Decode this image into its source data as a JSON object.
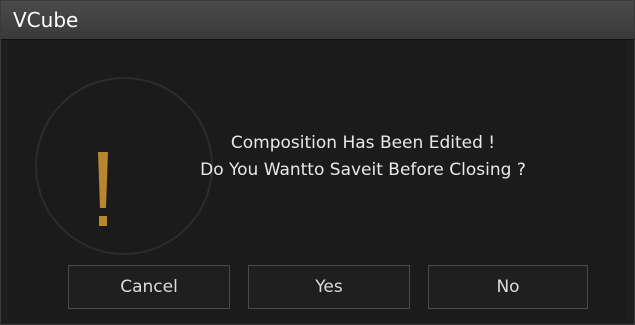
{
  "window": {
    "title": "VCube"
  },
  "dialog": {
    "icon": "warning-exclamation-icon",
    "message_line1": "Composition Has Been Edited !",
    "message_line2": "Do You Wantto Saveit Before Closing ?",
    "accent_color": "#b8862e"
  },
  "buttons": {
    "cancel": "Cancel",
    "yes": "Yes",
    "no": "No"
  }
}
